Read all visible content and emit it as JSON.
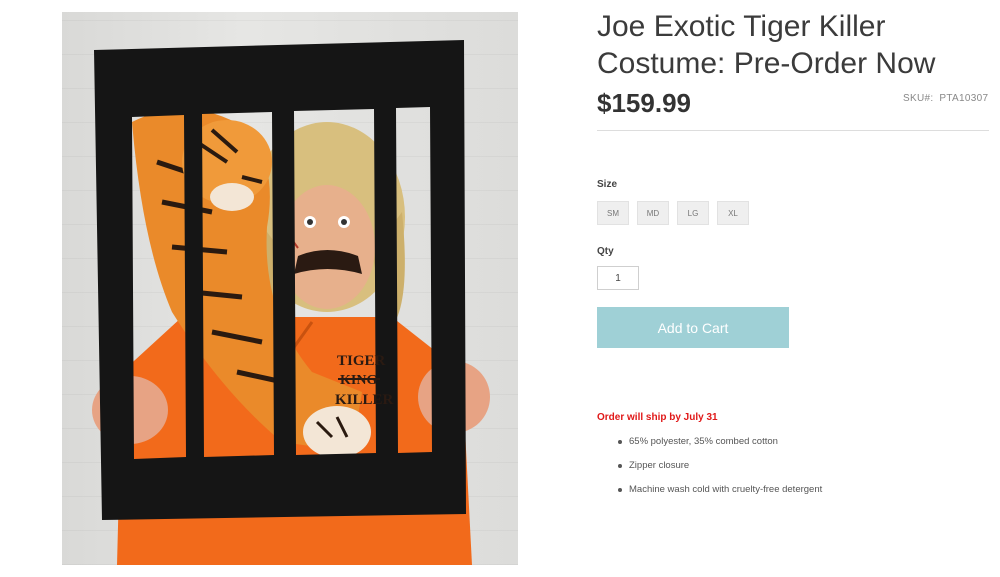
{
  "product": {
    "title": "Joe Exotic Tiger Killer Costume: Pre-Order Now",
    "price": "$159.99",
    "sku_label": "SKU#:",
    "sku_value": "PTA10307",
    "image_alt": "Man in orange jumpsuit with tiger plush behind cage frame prop"
  },
  "options": {
    "size_label": "Size",
    "sizes": [
      "SM",
      "MD",
      "LG",
      "XL"
    ],
    "qty_label": "Qty",
    "qty_value": "1",
    "add_to_cart": "Add to Cart"
  },
  "details": {
    "ship_notice": "Order will ship by July 31",
    "bullets": [
      "65% polyester, 35% combed cotton",
      "Zipper closure",
      "Machine wash cold with cruelty-free detergent"
    ]
  },
  "jumpsuit_text": [
    "TIGER",
    "KING",
    "KILLER"
  ],
  "colors": {
    "button": "#9fd0d6",
    "ship_notice": "#e01818",
    "jumpsuit": "#f26a1b",
    "frame": "#151515"
  }
}
